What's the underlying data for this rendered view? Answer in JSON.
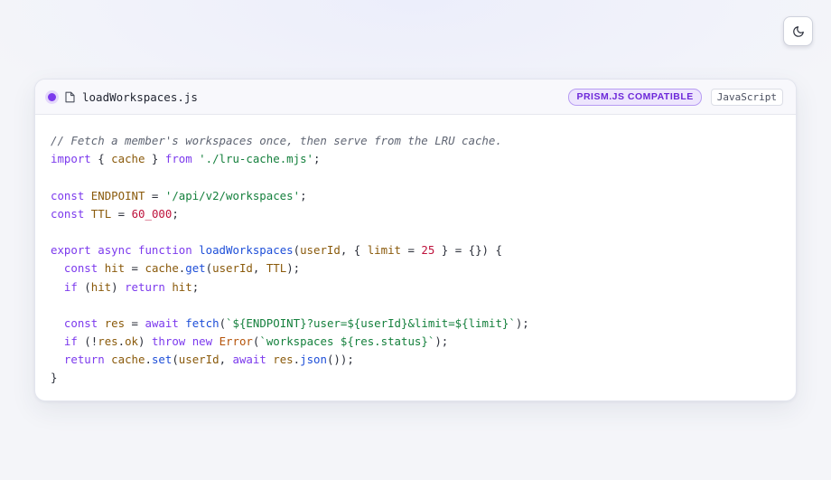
{
  "theme_toggle": {
    "icon": "moon-icon"
  },
  "header": {
    "filename": "loadWorkspaces.js",
    "compat_badge": "PRISM.JS COMPATIBLE",
    "language": "JavaScript",
    "accent_color": "#7c3aed"
  },
  "code": {
    "lines": [
      [
        {
          "t": "comment",
          "v": "// Fetch a member's workspaces once, then serve from the LRU cache."
        }
      ],
      [
        {
          "t": "keyword",
          "v": "import"
        },
        {
          "t": "punct",
          "v": " { "
        },
        {
          "t": "variable",
          "v": "cache"
        },
        {
          "t": "punct",
          "v": " } "
        },
        {
          "t": "keyword",
          "v": "from"
        },
        {
          "t": "punct",
          "v": " "
        },
        {
          "t": "string",
          "v": "'./lru-cache.mjs'"
        },
        {
          "t": "punct",
          "v": ";"
        }
      ],
      [],
      [
        {
          "t": "keyword",
          "v": "const"
        },
        {
          "t": "punct",
          "v": " "
        },
        {
          "t": "variable",
          "v": "ENDPOINT"
        },
        {
          "t": "punct",
          "v": " = "
        },
        {
          "t": "string",
          "v": "'/api/v2/workspaces'"
        },
        {
          "t": "punct",
          "v": ";"
        }
      ],
      [
        {
          "t": "keyword",
          "v": "const"
        },
        {
          "t": "punct",
          "v": " "
        },
        {
          "t": "variable",
          "v": "TTL"
        },
        {
          "t": "punct",
          "v": " = "
        },
        {
          "t": "number",
          "v": "60_000"
        },
        {
          "t": "punct",
          "v": ";"
        }
      ],
      [],
      [
        {
          "t": "keyword",
          "v": "export"
        },
        {
          "t": "punct",
          "v": " "
        },
        {
          "t": "keyword",
          "v": "async"
        },
        {
          "t": "punct",
          "v": " "
        },
        {
          "t": "keyword",
          "v": "function"
        },
        {
          "t": "punct",
          "v": " "
        },
        {
          "t": "function",
          "v": "loadWorkspaces"
        },
        {
          "t": "punct",
          "v": "("
        },
        {
          "t": "variable",
          "v": "userId"
        },
        {
          "t": "punct",
          "v": ", { "
        },
        {
          "t": "variable",
          "v": "limit"
        },
        {
          "t": "punct",
          "v": " = "
        },
        {
          "t": "number",
          "v": "25"
        },
        {
          "t": "punct",
          "v": " } = {}) {"
        }
      ],
      [
        {
          "t": "punct",
          "v": "  "
        },
        {
          "t": "keyword",
          "v": "const"
        },
        {
          "t": "punct",
          "v": " "
        },
        {
          "t": "variable",
          "v": "hit"
        },
        {
          "t": "punct",
          "v": " = "
        },
        {
          "t": "variable",
          "v": "cache"
        },
        {
          "t": "punct",
          "v": "."
        },
        {
          "t": "function",
          "v": "get"
        },
        {
          "t": "punct",
          "v": "("
        },
        {
          "t": "variable",
          "v": "userId"
        },
        {
          "t": "punct",
          "v": ", "
        },
        {
          "t": "variable",
          "v": "TTL"
        },
        {
          "t": "punct",
          "v": ");"
        }
      ],
      [
        {
          "t": "punct",
          "v": "  "
        },
        {
          "t": "keyword",
          "v": "if"
        },
        {
          "t": "punct",
          "v": " ("
        },
        {
          "t": "variable",
          "v": "hit"
        },
        {
          "t": "punct",
          "v": ") "
        },
        {
          "t": "keyword",
          "v": "return"
        },
        {
          "t": "punct",
          "v": " "
        },
        {
          "t": "variable",
          "v": "hit"
        },
        {
          "t": "punct",
          "v": ";"
        }
      ],
      [],
      [
        {
          "t": "punct",
          "v": "  "
        },
        {
          "t": "keyword",
          "v": "const"
        },
        {
          "t": "punct",
          "v": " "
        },
        {
          "t": "variable",
          "v": "res"
        },
        {
          "t": "punct",
          "v": " = "
        },
        {
          "t": "keyword",
          "v": "await"
        },
        {
          "t": "punct",
          "v": " "
        },
        {
          "t": "function",
          "v": "fetch"
        },
        {
          "t": "punct",
          "v": "("
        },
        {
          "t": "string",
          "v": "`${ENDPOINT}?user=${userId}&limit=${limit}`"
        },
        {
          "t": "punct",
          "v": ");"
        }
      ],
      [
        {
          "t": "punct",
          "v": "  "
        },
        {
          "t": "keyword",
          "v": "if"
        },
        {
          "t": "punct",
          "v": " (!"
        },
        {
          "t": "variable",
          "v": "res"
        },
        {
          "t": "punct",
          "v": "."
        },
        {
          "t": "variable",
          "v": "ok"
        },
        {
          "t": "punct",
          "v": ") "
        },
        {
          "t": "keyword",
          "v": "throw"
        },
        {
          "t": "punct",
          "v": " "
        },
        {
          "t": "keyword",
          "v": "new"
        },
        {
          "t": "punct",
          "v": " "
        },
        {
          "t": "class",
          "v": "Error"
        },
        {
          "t": "punct",
          "v": "("
        },
        {
          "t": "string",
          "v": "`workspaces ${res.status}`"
        },
        {
          "t": "punct",
          "v": ");"
        }
      ],
      [
        {
          "t": "punct",
          "v": "  "
        },
        {
          "t": "keyword",
          "v": "return"
        },
        {
          "t": "punct",
          "v": " "
        },
        {
          "t": "variable",
          "v": "cache"
        },
        {
          "t": "punct",
          "v": "."
        },
        {
          "t": "function",
          "v": "set"
        },
        {
          "t": "punct",
          "v": "("
        },
        {
          "t": "variable",
          "v": "userId"
        },
        {
          "t": "punct",
          "v": ", "
        },
        {
          "t": "keyword",
          "v": "await"
        },
        {
          "t": "punct",
          "v": " "
        },
        {
          "t": "variable",
          "v": "res"
        },
        {
          "t": "punct",
          "v": "."
        },
        {
          "t": "function",
          "v": "json"
        },
        {
          "t": "punct",
          "v": "());"
        }
      ],
      [
        {
          "t": "punct",
          "v": "}"
        }
      ]
    ]
  }
}
